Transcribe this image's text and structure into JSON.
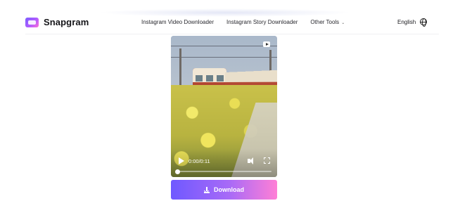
{
  "brand": {
    "name": "Snapgram",
    "logo_icon": "snapgram-logo-icon",
    "colors": {
      "accent_start": "#6f59ff",
      "accent_end": "#ff7fd6"
    }
  },
  "nav": {
    "items": [
      {
        "label": "Instagram Video Downloader"
      },
      {
        "label": "Instagram Story Downloader"
      },
      {
        "label": "Other Tools",
        "icon": "chevron-down-icon"
      }
    ]
  },
  "language": {
    "label": "English",
    "icon": "globe-icon"
  },
  "video": {
    "time": "0:00/0:11",
    "progress": 0.0,
    "controls": [
      "play-icon",
      "volume-muted-icon",
      "fullscreen-icon"
    ],
    "badge_icon": "play-badge-icon"
  },
  "download": {
    "label": "Download",
    "icon": "download-icon"
  }
}
